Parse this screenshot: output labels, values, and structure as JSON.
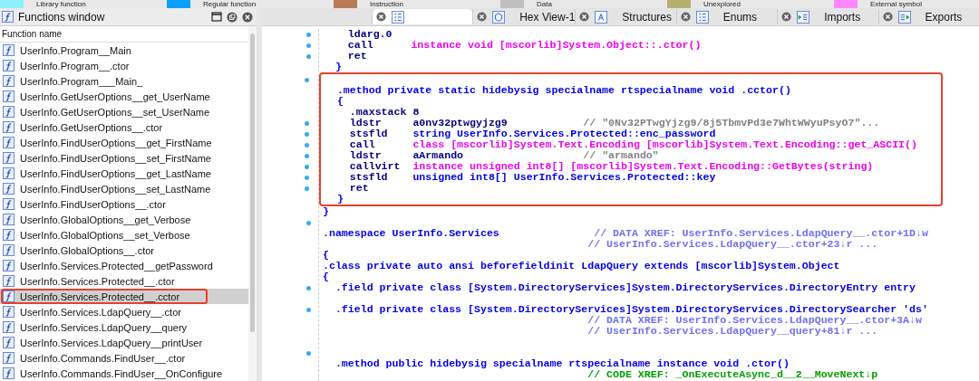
{
  "legend": [
    {
      "label": "Library function",
      "color": "#8cf0ff"
    },
    {
      "label": "Regular function",
      "color": "#0aa0ff"
    },
    {
      "label": "Instruction",
      "color": "#b87a55"
    },
    {
      "label": "Data",
      "color": "#c0c0c0"
    },
    {
      "label": "Unexplored",
      "color": "#b4b070"
    },
    {
      "label": "External symbol",
      "color": "#ff88ff"
    }
  ],
  "functions_window": {
    "title": "Functions window",
    "column": "Function name",
    "items": [
      {
        "name": "UserInfo.Program__Main",
        "selected": false,
        "highlighted": false
      },
      {
        "name": "UserInfo.Program__.ctor",
        "selected": false,
        "highlighted": false
      },
      {
        "name": "UserInfo.Program___Main_",
        "selected": false,
        "highlighted": false
      },
      {
        "name": "UserInfo.GetUserOptions__get_UserName",
        "selected": false,
        "highlighted": false
      },
      {
        "name": "UserInfo.GetUserOptions__set_UserName",
        "selected": false,
        "highlighted": false
      },
      {
        "name": "UserInfo.GetUserOptions__.ctor",
        "selected": false,
        "highlighted": false
      },
      {
        "name": "UserInfo.FindUserOptions__get_FirstName",
        "selected": false,
        "highlighted": false
      },
      {
        "name": "UserInfo.FindUserOptions__set_FirstName",
        "selected": false,
        "highlighted": false
      },
      {
        "name": "UserInfo.FindUserOptions__get_LastName",
        "selected": false,
        "highlighted": false
      },
      {
        "name": "UserInfo.FindUserOptions__set_LastName",
        "selected": false,
        "highlighted": false
      },
      {
        "name": "UserInfo.FindUserOptions__.ctor",
        "selected": false,
        "highlighted": false
      },
      {
        "name": "UserInfo.GlobalOptions__get_Verbose",
        "selected": false,
        "highlighted": false
      },
      {
        "name": "UserInfo.GlobalOptions__set_Verbose",
        "selected": false,
        "highlighted": false
      },
      {
        "name": "UserInfo.GlobalOptions__.ctor",
        "selected": false,
        "highlighted": false
      },
      {
        "name": "UserInfo.Services.Protected__getPassword",
        "selected": false,
        "highlighted": false
      },
      {
        "name": "UserInfo.Services.Protected__.ctor",
        "selected": false,
        "highlighted": false
      },
      {
        "name": "UserInfo.Services.Protected__.cctor",
        "selected": true,
        "highlighted": true
      },
      {
        "name": "UserInfo.Services.LdapQuery__.ctor",
        "selected": false,
        "highlighted": false
      },
      {
        "name": "UserInfo.Services.LdapQuery__query",
        "selected": false,
        "highlighted": false
      },
      {
        "name": "UserInfo.Services.LdapQuery__printUser",
        "selected": false,
        "highlighted": false
      },
      {
        "name": "UserInfo.Commands.FindUser__.ctor",
        "selected": false,
        "highlighted": false
      },
      {
        "name": "UserInfo.Commands.FindUser__OnConfigure",
        "selected": false,
        "highlighted": false
      }
    ]
  },
  "tabs": [
    {
      "kind": "disasm",
      "selected": true
    },
    {
      "label": "Hex View-1",
      "kind": "hex",
      "selected": false
    },
    {
      "label": "Structures",
      "kind": "struct",
      "selected": false
    },
    {
      "label": "Enums",
      "kind": "enum",
      "selected": false
    },
    {
      "label": "Imports",
      "kind": "imports",
      "selected": false
    },
    {
      "label": "Exports",
      "kind": "exports",
      "selected": false
    }
  ],
  "code_blocks": [
    {
      "boxed": false,
      "lines": [
        {
          "dot": true,
          "parts": [
            {
              "text": "    ldarg.0",
              "kind": "kw"
            }
          ]
        },
        {
          "dot": true,
          "parts": [
            {
              "text": "    call      ",
              "kind": "kw"
            },
            {
              "text": "instance void [mscorlib]System.Object::.ctor()",
              "kind": "mag"
            }
          ]
        },
        {
          "dot": true,
          "parts": [
            {
              "text": "    ret",
              "kind": "kw"
            }
          ]
        },
        {
          "dot": false,
          "parts": [
            {
              "text": "  }",
              "kind": "op"
            }
          ]
        }
      ]
    },
    {
      "boxed": true,
      "lines": [
        {
          "dot": true
        },
        {
          "dot": false,
          "parts": [
            {
              "text": "  .method private static hidebysig specialname rtspecialname void .cctor()",
              "kind": "op"
            }
          ]
        },
        {
          "dot": false,
          "parts": [
            {
              "text": "  {",
              "kind": "op"
            }
          ]
        },
        {
          "dot": false,
          "parts": [
            {
              "text": "    .maxstack 8",
              "kind": "kw"
            }
          ]
        },
        {
          "dot": true,
          "parts": [
            {
              "text": "    ldstr     ",
              "kind": "kw"
            },
            {
              "text": "a0nv32ptwgyjzg9            ",
              "kind": "kw"
            },
            {
              "text": "// \"0Nv32PTwgYjzg9/8j5TbmvPd3e7WhtWWyuPsyO7\"...",
              "kind": "str"
            }
          ]
        },
        {
          "dot": true,
          "parts": [
            {
              "text": "    stsfld    ",
              "kind": "kw"
            },
            {
              "text": "string UserInfo.Services.Protected::enc_password",
              "kind": "op"
            }
          ]
        },
        {
          "dot": true,
          "parts": [
            {
              "text": "    call      ",
              "kind": "kw"
            },
            {
              "text": "class [mscorlib]System.Text.Encoding [mscorlib]System.Text.Encoding::get_ASCII()",
              "kind": "mag"
            }
          ]
        },
        {
          "dot": true,
          "parts": [
            {
              "text": "    ldstr     ",
              "kind": "kw"
            },
            {
              "text": "aArmando                   ",
              "kind": "kw"
            },
            {
              "text": "// \"armando\"",
              "kind": "str"
            }
          ]
        },
        {
          "dot": true,
          "parts": [
            {
              "text": "    callvirt  ",
              "kind": "kw"
            },
            {
              "text": "instance unsigned int8[] [mscorlib]System.Text.Encoding::GetBytes(string)",
              "kind": "mag"
            }
          ]
        },
        {
          "dot": true,
          "parts": [
            {
              "text": "    stsfld    ",
              "kind": "kw"
            },
            {
              "text": "unsigned int8[] UserInfo.Services.Protected::key",
              "kind": "op"
            }
          ]
        },
        {
          "dot": true,
          "parts": [
            {
              "text": "    ret",
              "kind": "kw"
            }
          ]
        },
        {
          "dot": false,
          "parts": [
            {
              "text": "  }",
              "kind": "op"
            }
          ]
        }
      ]
    },
    {
      "boxed": false,
      "lines": [
        {
          "dot": false,
          "parts": [
            {
              "text": "}",
              "kind": "op"
            }
          ]
        },
        {
          "dot": true
        },
        {
          "dot": false,
          "parts": [
            {
              "text": ".namespace UserInfo.Services               ",
              "kind": "op"
            },
            {
              "text": "// DATA XREF: UserInfo.Services.LdapQuery__.ctor+1D↓w",
              "kind": "xref"
            }
          ]
        },
        {
          "dot": false,
          "parts": [
            {
              "text": "// UserInfo.Services.LdapQuery__.ctor+23↓r ...",
              "kind": "xref_cont"
            }
          ]
        },
        {
          "dot": false,
          "parts": [
            {
              "text": "{",
              "kind": "op"
            }
          ]
        },
        {
          "dot": false,
          "parts": [
            {
              "text": ".class private auto ansi beforefieldinit LdapQuery extends [mscorlib]System.Object",
              "kind": "op"
            }
          ]
        },
        {
          "dot": false,
          "parts": [
            {
              "text": "{",
              "kind": "op"
            }
          ]
        },
        {
          "dot": true,
          "parts": [
            {
              "text": "  .field private class [System.DirectoryServices]System.DirectoryServices.DirectoryEntry entry",
              "kind": "op"
            }
          ]
        },
        {
          "dot": false
        },
        {
          "dot": true,
          "parts": [
            {
              "text": "  .field private class [System.DirectoryServices]System.DirectoryServices.DirectorySearcher 'ds'",
              "kind": "op"
            }
          ]
        },
        {
          "dot": false,
          "parts": [
            {
              "text": "// DATA XREF: UserInfo.Services.LdapQuery__.ctor+3A↓w",
              "kind": "xref_cont"
            }
          ]
        },
        {
          "dot": false,
          "parts": [
            {
              "text": "// UserInfo.Services.LdapQuery__query+81↓r ...",
              "kind": "xref_cont"
            }
          ]
        },
        {
          "dot": false
        },
        {
          "dot": true
        },
        {
          "dot": false,
          "parts": [
            {
              "text": "  .method public hidebysig specialname rtspecialname instance void .ctor()",
              "kind": "op"
            }
          ]
        },
        {
          "dot": false,
          "parts": [
            {
              "text": "// CODE XREF: _OnExecuteAsync_d__2__MoveNext↓p",
              "kind": "code_cont"
            }
          ]
        }
      ]
    }
  ]
}
